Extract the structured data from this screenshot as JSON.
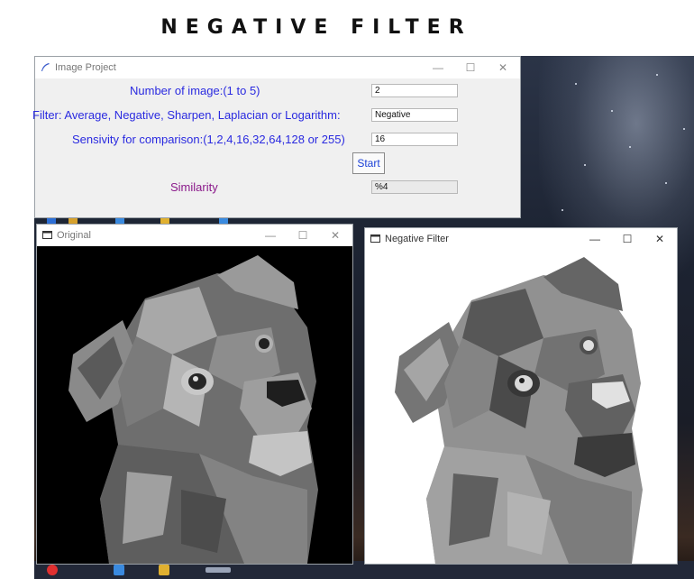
{
  "page": {
    "title": "NEGATIVE FILTER"
  },
  "main_window": {
    "title": "Image Project",
    "controls": {
      "minimize": "—",
      "maximize": "☐",
      "close": "✕"
    },
    "num_label": "Number of image:(1 to 5)",
    "num_value": "2",
    "filter_label": "Filter: Average, Negative, Sharpen, Laplacian or Logarithm:",
    "filter_value": "Negative",
    "sens_label": "Sensivity for comparison:(1,2,4,16,32,64,128 or 255)",
    "sens_value": "16",
    "start_label": "Start",
    "similarity_label": "Similarity",
    "similarity_value": "%4"
  },
  "original_window": {
    "title": "Original",
    "controls": {
      "minimize": "—",
      "maximize": "☐",
      "close": "✕"
    }
  },
  "negative_window": {
    "title": "Negative Filter",
    "controls": {
      "minimize": "—",
      "maximize": "☐",
      "close": "✕"
    }
  },
  "icons": [
    "feather-icon",
    "window-icon",
    "dog-image",
    "inverted-dog-image"
  ]
}
